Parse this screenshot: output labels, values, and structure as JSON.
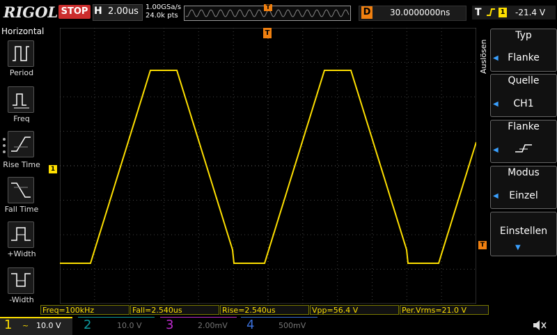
{
  "header": {
    "brand": "RIGOL",
    "run_state": "STOP",
    "horizontal_letter": "H",
    "timebase": "2.00us",
    "sample_rate": "1.00GSa/s",
    "memory_depth": "24.0k pts",
    "trigger_position_marker": "T",
    "delay_letter": "D",
    "delay_value": "30.0000000ns",
    "trigger_letter": "T",
    "trigger_channel": "1",
    "trigger_level": "-21.4 V"
  },
  "left_menu": {
    "title": "Horizontal",
    "items": [
      {
        "label": "Period",
        "icon": "period-icon"
      },
      {
        "label": "Freq",
        "icon": "frequency-icon"
      },
      {
        "label": "Rise Time",
        "icon": "rise-time-icon"
      },
      {
        "label": "Fall Time",
        "icon": "fall-time-icon"
      },
      {
        "label": "+Width",
        "icon": "positive-width-icon"
      },
      {
        "label": "-Width",
        "icon": "negative-width-icon"
      }
    ]
  },
  "right_menu": {
    "title": "Auslösen",
    "softkeys": [
      {
        "title": "Typ",
        "value": "Flanke"
      },
      {
        "title": "Quelle",
        "value": "CH1"
      },
      {
        "title": "Flanke",
        "value": "rising-edge-icon"
      },
      {
        "title": "Modus",
        "value": "Einzel"
      },
      {
        "title": "Einstellen",
        "value": ""
      }
    ]
  },
  "markers": {
    "channel1_ground": "1",
    "trigger_top": "T",
    "trigger_level_arrow": "T"
  },
  "measurements": [
    {
      "label": "Freq=100kHz"
    },
    {
      "label": "Fall=2.540us"
    },
    {
      "label": "Rise=2.540us"
    },
    {
      "label": "Vpp=56.4 V"
    },
    {
      "label": "Per.Vrms=21.0 V"
    }
  ],
  "channels": [
    {
      "num": "1",
      "coupling": "~",
      "scale": "10.0 V",
      "color": "#ffe000",
      "active": true
    },
    {
      "num": "2",
      "scale": "10.0 V",
      "color": "#0e9aa0",
      "active": false
    },
    {
      "num": "3",
      "scale": "2.00mV",
      "color": "#c02bd0",
      "active": false
    },
    {
      "num": "4",
      "scale": "500mV",
      "color": "#3a6fd8",
      "active": false
    }
  ],
  "colors": {
    "trace": "#ffe000",
    "trigger": "#f08010",
    "stop": "#cc2d2d",
    "softkey_arrow": "#3aa0ff"
  }
}
